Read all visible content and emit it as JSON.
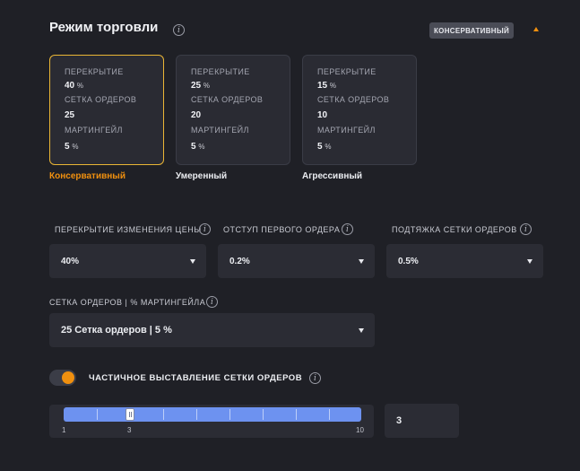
{
  "header": {
    "title": "Режим торговли",
    "mode_badge": "КОНСЕРВАТИВНЫЙ"
  },
  "presets": [
    {
      "name": "Консервативный",
      "selected": true,
      "overlap_label": "ПЕРЕКРЫТИЕ",
      "overlap_value": "40",
      "grid_label": "СЕТКА ОРДЕРОВ",
      "grid_value": "25",
      "martingale_label": "МАРТИНГЕЙЛ",
      "martingale_value": "5",
      "unit": "%"
    },
    {
      "name": "Умеренный",
      "selected": false,
      "overlap_label": "ПЕРЕКРЫТИЕ",
      "overlap_value": "25",
      "grid_label": "СЕТКА ОРДЕРОВ",
      "grid_value": "20",
      "martingale_label": "МАРТИНГЕЙЛ",
      "martingale_value": "5",
      "unit": "%"
    },
    {
      "name": "Агрессивный",
      "selected": false,
      "overlap_label": "ПЕРЕКРЫТИЕ",
      "overlap_value": "15",
      "grid_label": "СЕТКА ОРДЕРОВ",
      "grid_value": "10",
      "martingale_label": "МАРТИНГЕЙЛ",
      "martingale_value": "5",
      "unit": "%"
    }
  ],
  "settings": {
    "price_overlap": {
      "label": "ПЕРЕКРЫТИЕ ИЗМЕНЕНИЯ ЦЕНЫ",
      "value": "40%"
    },
    "first_order_offset": {
      "label": "ОТСТУП ПЕРВОГО ОРДЕРА",
      "value": "0.2%"
    },
    "grid_pullup": {
      "label": "ПОДТЯЖКА СЕТКИ ОРДЕРОВ",
      "value": "0.5%"
    },
    "grid_martingale": {
      "label": "СЕТКА ОРДЕРОВ | % МАРТИНГЕЙЛА",
      "value": "25 Сетка ордеров | 5 %"
    }
  },
  "partial_grid": {
    "label": "ЧАСТИЧНОЕ ВЫСТАВЛЕНИЕ СЕТКИ ОРДЕРОВ",
    "enabled": true,
    "slider_min": "1",
    "slider_current_label": "3",
    "slider_max": "10",
    "value": "3"
  },
  "colors": {
    "accent": "#f0900f",
    "selected_border": "#e9b535",
    "slider_fill": "#6d92f0"
  },
  "icons": {
    "info": "i",
    "collapse": "triangle-up",
    "dropdown": "triangle-down"
  }
}
